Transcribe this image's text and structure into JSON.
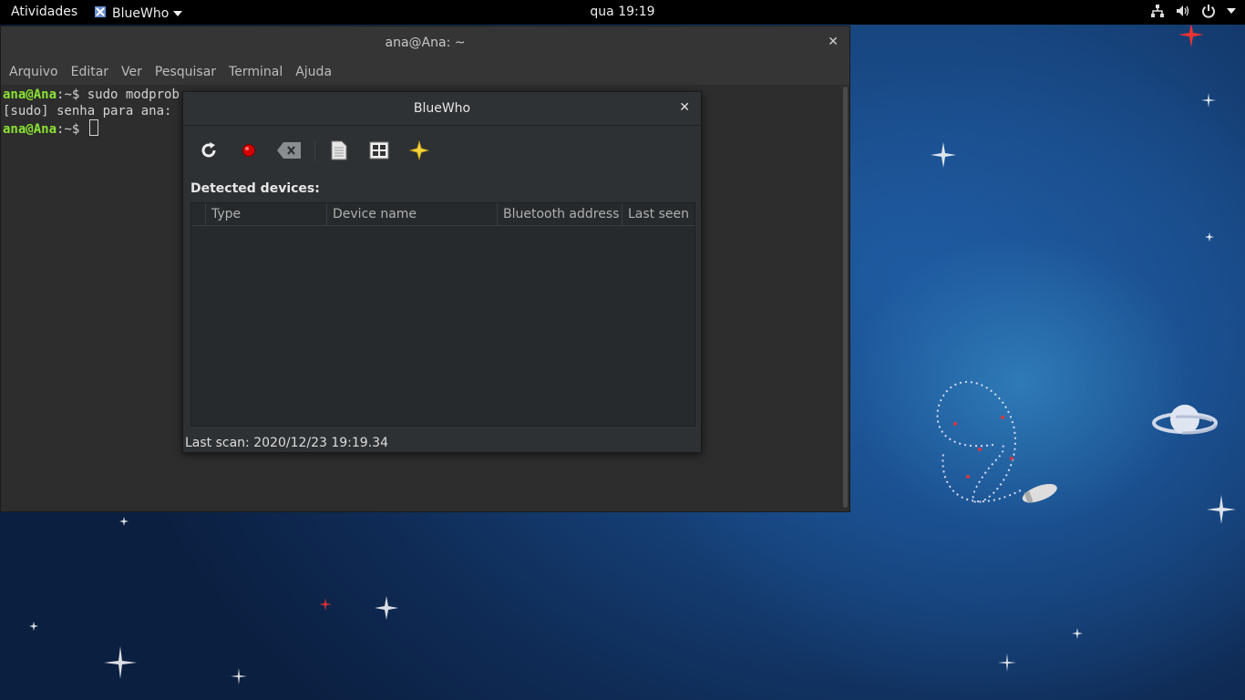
{
  "topbar": {
    "activities": "Atividades",
    "app_name": "BlueWho",
    "clock": "qua 19:19"
  },
  "terminal": {
    "title": "ana@Ana: ~",
    "menu": [
      "Arquivo",
      "Editar",
      "Ver",
      "Pesquisar",
      "Terminal",
      "Ajuda"
    ],
    "lines": {
      "l1_user": "ana@Ana",
      "l1_rest": ":~$ sudo modprob",
      "l2": "[sudo] senha para ana:",
      "l3_user": "ana@Ana",
      "l3_rest": ":~$ "
    }
  },
  "bluewho": {
    "title": "BlueWho",
    "detected_label": "Detected devices:",
    "columns": [
      "Type",
      "Device name",
      "Bluetooth address",
      "Last seen"
    ],
    "status": "Last scan: 2020/12/23 19:19.34"
  },
  "icons": {
    "refresh": "refresh-icon",
    "record": "record-icon",
    "clear": "clear-icon",
    "document": "document-icon",
    "settings": "settings-icon",
    "about": "star-icon"
  },
  "colors": {
    "prompt": "#8ae234",
    "desktop": "#17457f"
  }
}
